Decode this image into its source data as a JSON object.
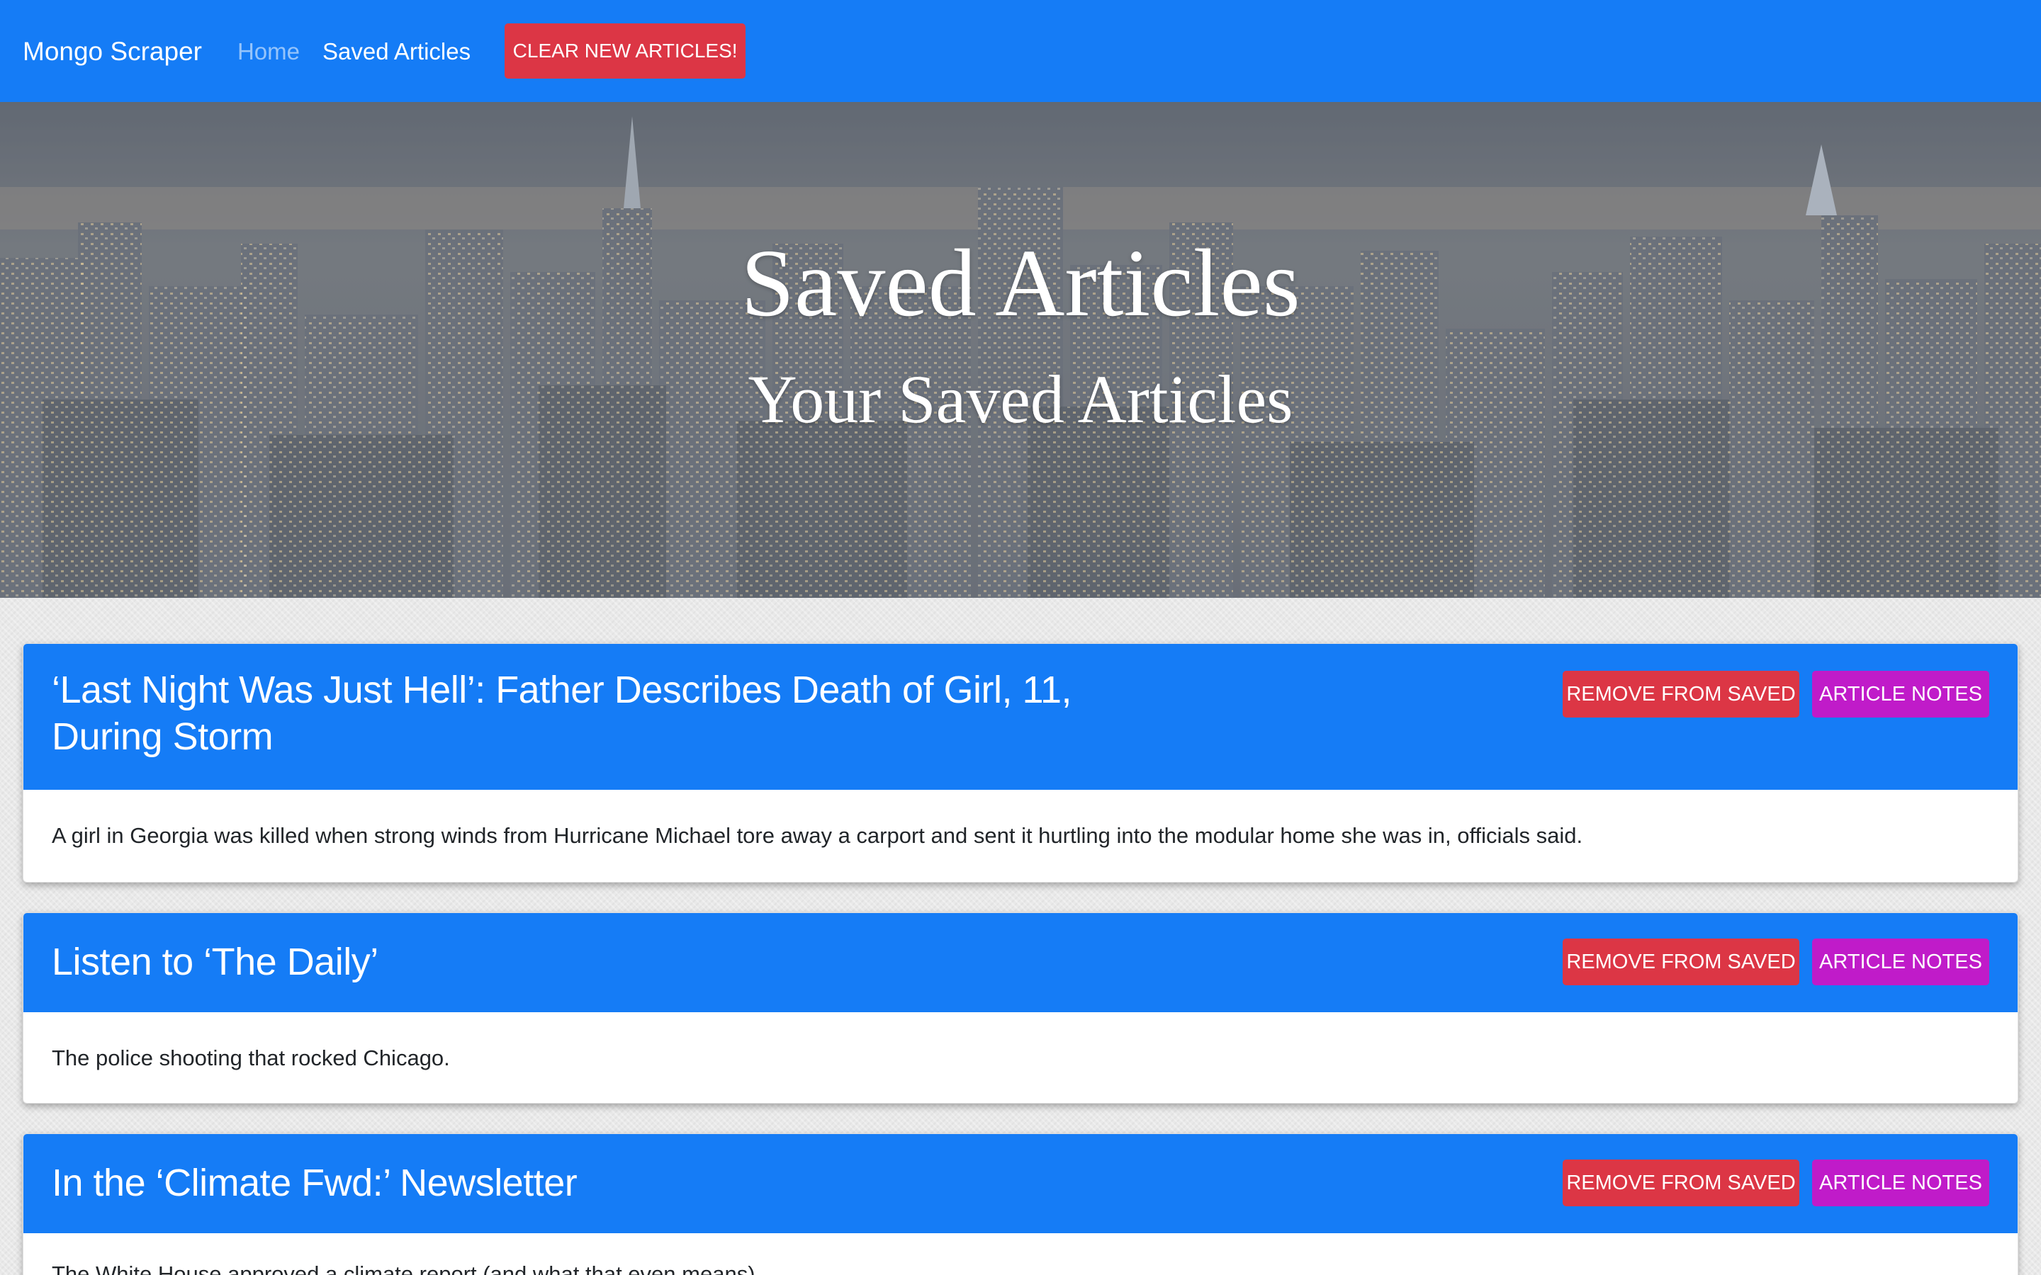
{
  "navbar": {
    "brand": "Mongo Scraper",
    "links": [
      {
        "label": "Home"
      },
      {
        "label": "Saved Articles"
      }
    ],
    "clear_button": "CLEAR NEW ARTICLES!"
  },
  "hero": {
    "title": "Saved Articles",
    "subtitle": "Your Saved Articles"
  },
  "articles": [
    {
      "title_line1": "‘Last Night Was Just Hell’: Father Describes Death of Girl, 11,",
      "title_line2": "During Storm",
      "summary": "A girl in Georgia was killed when strong winds from Hurricane Michael tore away a carport and sent it hurtling into the modular home she was in, officials said."
    },
    {
      "title_line1": "Listen to ‘The Daily’",
      "summary": "The police shooting that rocked Chicago."
    },
    {
      "title_line1": "In the ‘Climate Fwd:’ Newsletter",
      "summary": "The White House approved a climate report (and what that even means)."
    }
  ],
  "card_buttons": {
    "remove": "REMOVE FROM SAVED",
    "notes": "ARTICLE NOTES"
  },
  "colors": {
    "primary": "#157cf6",
    "danger": "#dc3645",
    "notes": "#c01bc9"
  }
}
